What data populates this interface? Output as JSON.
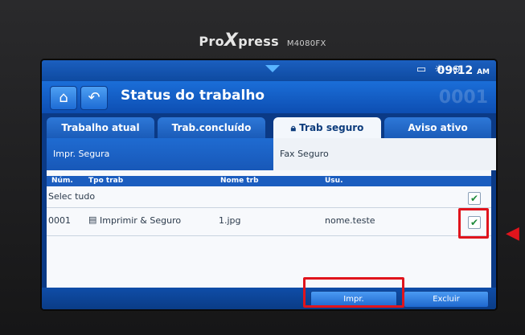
{
  "device": {
    "brand_pre": "Pro",
    "brand_x": "X",
    "brand_post": "press",
    "model": "M4080FX"
  },
  "status_bar": {
    "time": "09:12",
    "ampm": "AM",
    "icons": [
      "toner-icon",
      "brightness-icon",
      "globe-icon"
    ]
  },
  "header": {
    "title": "Status do trabalho",
    "home_icon": "home-icon",
    "back_icon": "back-icon"
  },
  "tabs": [
    {
      "label": "Trabalho atual",
      "active": false
    },
    {
      "label": "Trab.concluído",
      "active": false
    },
    {
      "label": "Trab seguro",
      "active": true
    },
    {
      "label": "Aviso ativo",
      "active": false
    }
  ],
  "subtabs": {
    "left": "Impr. Segura",
    "right": "Fax Seguro"
  },
  "table": {
    "columns": [
      "Núm.",
      "Tpo trab",
      "Nome trb",
      "Usu."
    ],
    "select_all_label": "Selec tudo",
    "select_all_checked": true,
    "rows": [
      {
        "num": "0001",
        "type": "Imprimir & Seguro",
        "name": "1.jpg",
        "user": "nome.teste",
        "checked": true
      }
    ]
  },
  "actions": {
    "print_label": "Impr.",
    "delete_label": "Excluir"
  },
  "colors": {
    "highlight": "#e0141c",
    "accent_blue": "#1b6ed8",
    "check_green": "#1f8a3a"
  }
}
